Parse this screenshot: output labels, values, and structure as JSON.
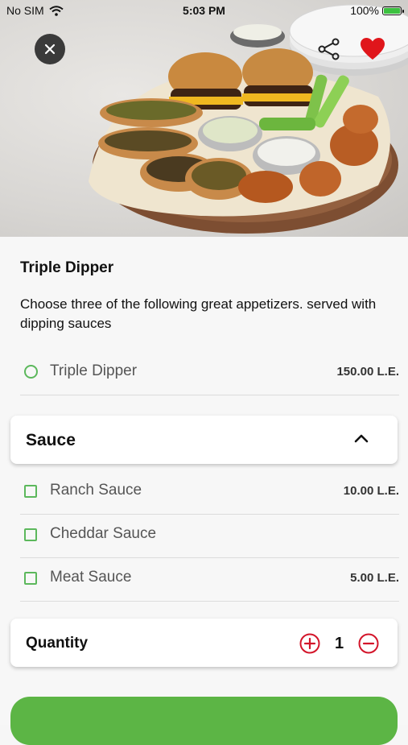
{
  "status_bar": {
    "carrier": "No SIM",
    "time": "5:03 PM",
    "battery": "100%",
    "battery_level": 1.0
  },
  "item": {
    "title": "Triple Dipper",
    "description": "Choose three of the following great appetizers. served with dipping sauces"
  },
  "size_options": [
    {
      "label": "Triple Dipper",
      "price": "150.00 L.E."
    }
  ],
  "sauce_section": {
    "title": "Sauce",
    "options": [
      {
        "label": "Ranch Sauce",
        "price": "10.00 L.E."
      },
      {
        "label": "Cheddar Sauce",
        "price": ""
      },
      {
        "label": "Meat Sauce",
        "price": "5.00 L.E."
      }
    ]
  },
  "quantity": {
    "label": "Quantity",
    "value": "1"
  },
  "colors": {
    "accent_green": "#5cb85c",
    "button_green": "#5cb545",
    "heart_red": "#e0161b",
    "stepper_red": "#d3152a"
  },
  "icons": [
    "wifi-icon",
    "battery-icon",
    "close-icon",
    "share-icon",
    "heart-icon",
    "chevron-up-icon",
    "plus-circle-icon",
    "minus-circle-icon"
  ]
}
